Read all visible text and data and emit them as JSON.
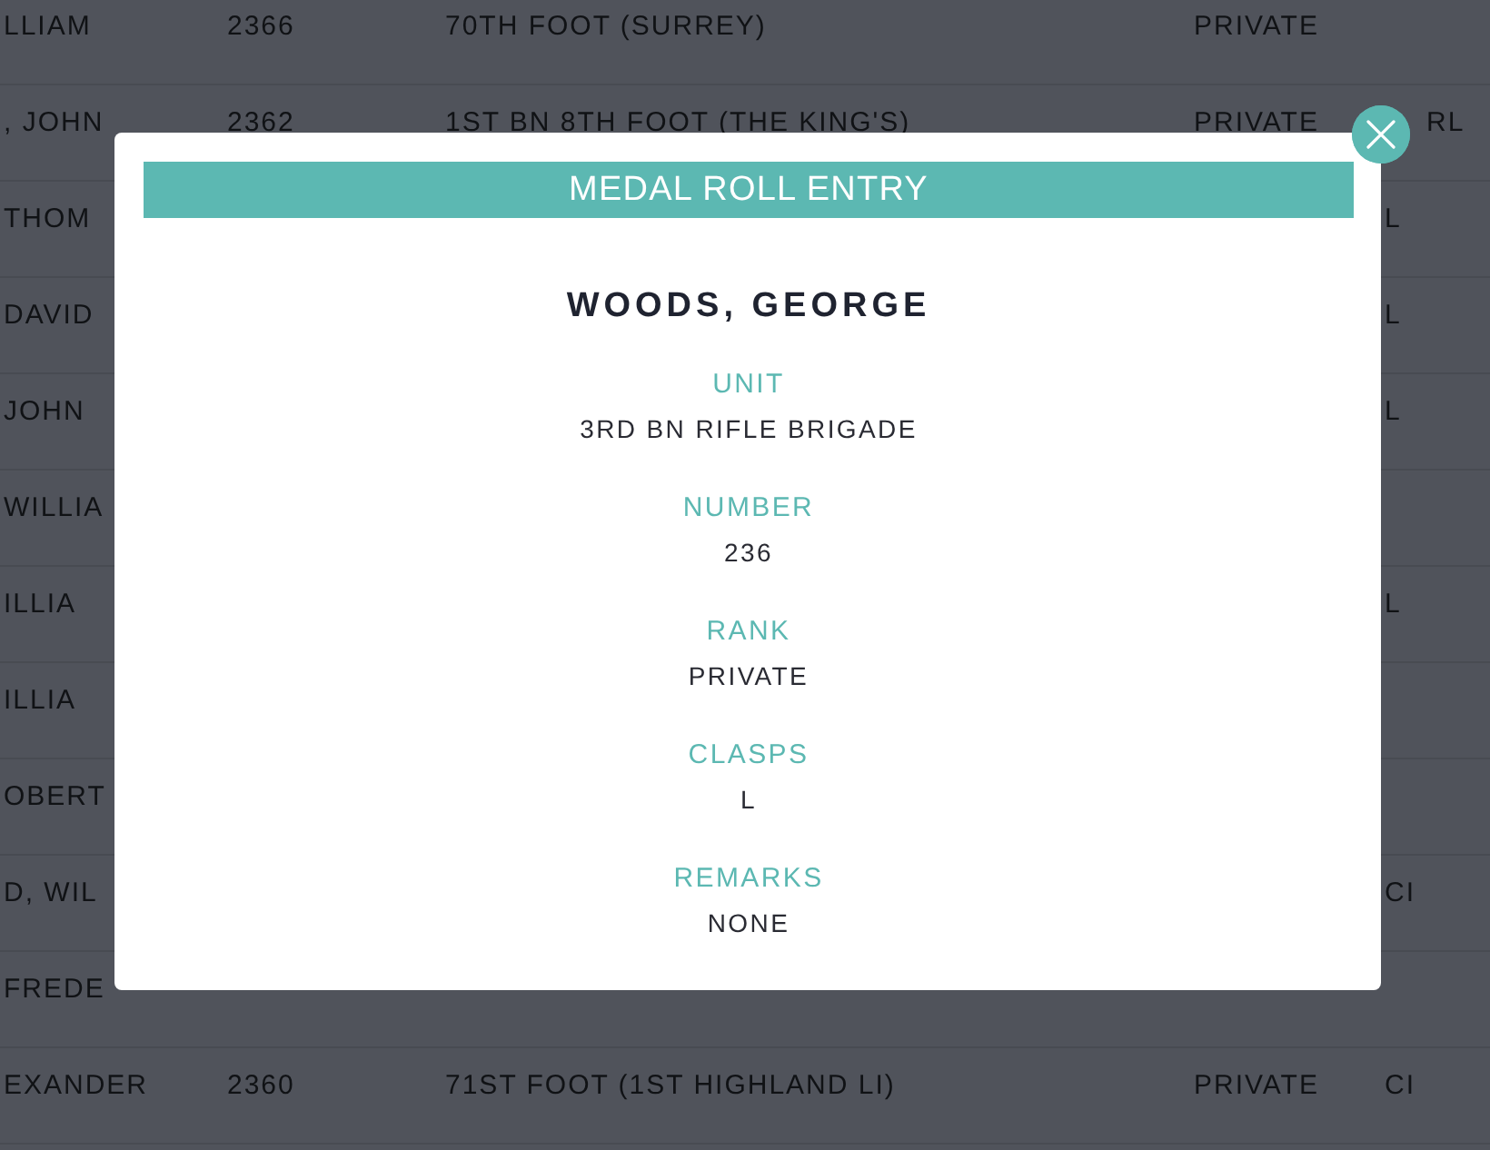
{
  "table": {
    "rows": [
      {
        "name": "LLIAM",
        "number": "2366",
        "unit": "70TH FOOT (SURREY)",
        "rank": "PRIVATE"
      },
      {
        "name": ", JOHN",
        "number": "2362",
        "unit": "1ST BN 8TH FOOT (THE KING'S)",
        "rank": "PRIVATE",
        "clasps": "RL"
      },
      {
        "name": "THOM",
        "clasps": "L"
      },
      {
        "name": "DAVID",
        "clasps": "L"
      },
      {
        "name": "JOHN",
        "clasps": "L"
      },
      {
        "name": "WILLIA"
      },
      {
        "name": "ILLIA",
        "clasps": "L"
      },
      {
        "name": "ILLIA"
      },
      {
        "name": "OBERT"
      },
      {
        "name": "D, WIL",
        "clasps": "CI"
      },
      {
        "name": "FREDE"
      },
      {
        "name": "EXANDER",
        "number": "2360",
        "unit": "71ST FOOT (1ST HIGHLAND LI)",
        "rank": "PRIVATE",
        "clasps": "CI"
      }
    ]
  },
  "modal": {
    "title": "MEDAL ROLL ENTRY",
    "name": "WOODS, GEORGE",
    "fields": [
      {
        "label": "UNIT",
        "value": "3RD BN RIFLE BRIGADE"
      },
      {
        "label": "NUMBER",
        "value": "236"
      },
      {
        "label": "RANK",
        "value": "PRIVATE"
      },
      {
        "label": "CLASPS",
        "value": "L"
      },
      {
        "label": "REMARKS",
        "value": "NONE"
      }
    ]
  }
}
